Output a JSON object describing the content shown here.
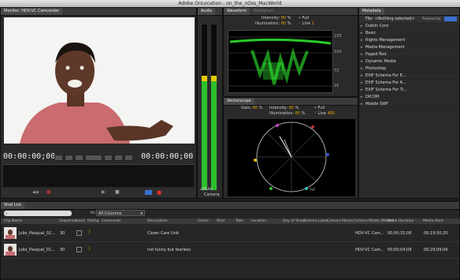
{
  "window": {
    "title": "Adobe OnLocation - on_the_nOss_MacWorld"
  },
  "monitor": {
    "tab": "Monitor: HDV-VC Camcorder",
    "timecode_left": "00:00:00;00",
    "timecode_right": "00:00:00;00"
  },
  "audio": {
    "tab": "Audio",
    "mute_label": "Mute",
    "camera_label": "Camera",
    "meter_level_left": 0.69,
    "meter_level_right": 0.69
  },
  "waveform": {
    "tabs": [
      "Waveform",
      "Histogram"
    ],
    "intensity_label": "Intensity:",
    "intensity_value": "80",
    "intensity_unit": "%",
    "illumination_label": "Illumination:",
    "illumination_value": "80",
    "illumination_unit": "%",
    "full_label": "Full",
    "line_label": "Line",
    "line_value": "1",
    "scale": [
      "235",
      "100",
      "72",
      "16"
    ]
  },
  "vectorscope": {
    "tab": "Vectorscope",
    "gain_label": "Gain:",
    "gain_value": "80",
    "gain_unit": "%",
    "intensity_label": "Intensity:",
    "intensity_value": "80",
    "intensity_unit": "%",
    "illumination_label": "Illumination:",
    "illumination_value": "80",
    "illumination_unit": "%",
    "full_label": "Full",
    "line_label": "Line",
    "line_value": "480",
    "ysq_label": "YxT"
  },
  "metadata": {
    "tab": "Metadata",
    "file_label": "File:",
    "file_value": "<Nothing selected>",
    "powered_by": "Powered By",
    "items": [
      "Dublin Core",
      "Basic",
      "Rights Management",
      "Media Management",
      "Paged-Text",
      "Dynamic Media",
      "Photoshop",
      "EXIF Schema For E...",
      "EXIF Schema For A...",
      "EXIF Schema For TI...",
      "DICOM",
      "Mobile SWF"
    ]
  },
  "shotlist": {
    "tab": "Shot List",
    "in_label": "In:",
    "in_value": "All Columns",
    "columns": [
      "Clip Name",
      "Sequence",
      "Good",
      "Rating",
      "Comments",
      "Description",
      "Scene",
      "Shot",
      "Take",
      "Location",
      "Day of Shoot",
      "Camera Label",
      "Camera Moves",
      "Camera Model (Model)",
      "Media Duration",
      "Media Start"
    ],
    "rows": [
      {
        "name": "Julie_Pasqual_02...",
        "sequence": "30",
        "description": "Clown Care Unit",
        "camera": "HDV-VC Cam...",
        "duration": "00;00;32;06",
        "start": "00;19;50;20"
      },
      {
        "name": "Julie_Pasqual_01...",
        "sequence": "30",
        "description": "not funny but fearless",
        "camera": "HDV-VC Cam...",
        "duration": "00;00;04;09",
        "start": "00;29;09;06"
      }
    ]
  },
  "colors": {
    "accent": "#3a6fd0",
    "meter_green": "#2dbf2d",
    "meter_yellow": "#e8c800",
    "waveform_green": "#33ff33"
  }
}
